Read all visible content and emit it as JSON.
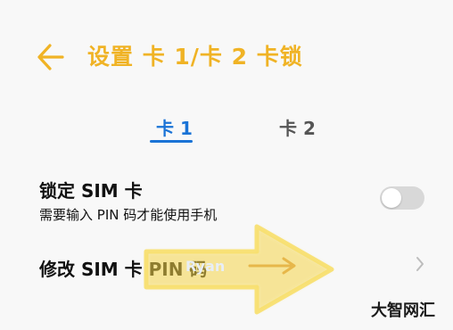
{
  "header": {
    "title": "设置 卡 1/卡 2 卡锁",
    "back_icon": "arrow-left-icon",
    "accent_color": "#f0b325"
  },
  "tabs": {
    "items": [
      {
        "label": "卡 1",
        "selected": true
      },
      {
        "label": "卡 2",
        "selected": false
      }
    ],
    "active_color": "#1a73d6"
  },
  "lock_sim": {
    "label": "锁定 SIM 卡",
    "description": "需要输入 PIN 码才能使用手机",
    "enabled": false
  },
  "change_pin": {
    "label": "修改 SIM 卡 PIN 码",
    "chevron_icon": "chevron-right-icon"
  },
  "watermark": {
    "text": "Ryan",
    "logo": "大智网汇",
    "arrow_color": "#f5d54a"
  }
}
